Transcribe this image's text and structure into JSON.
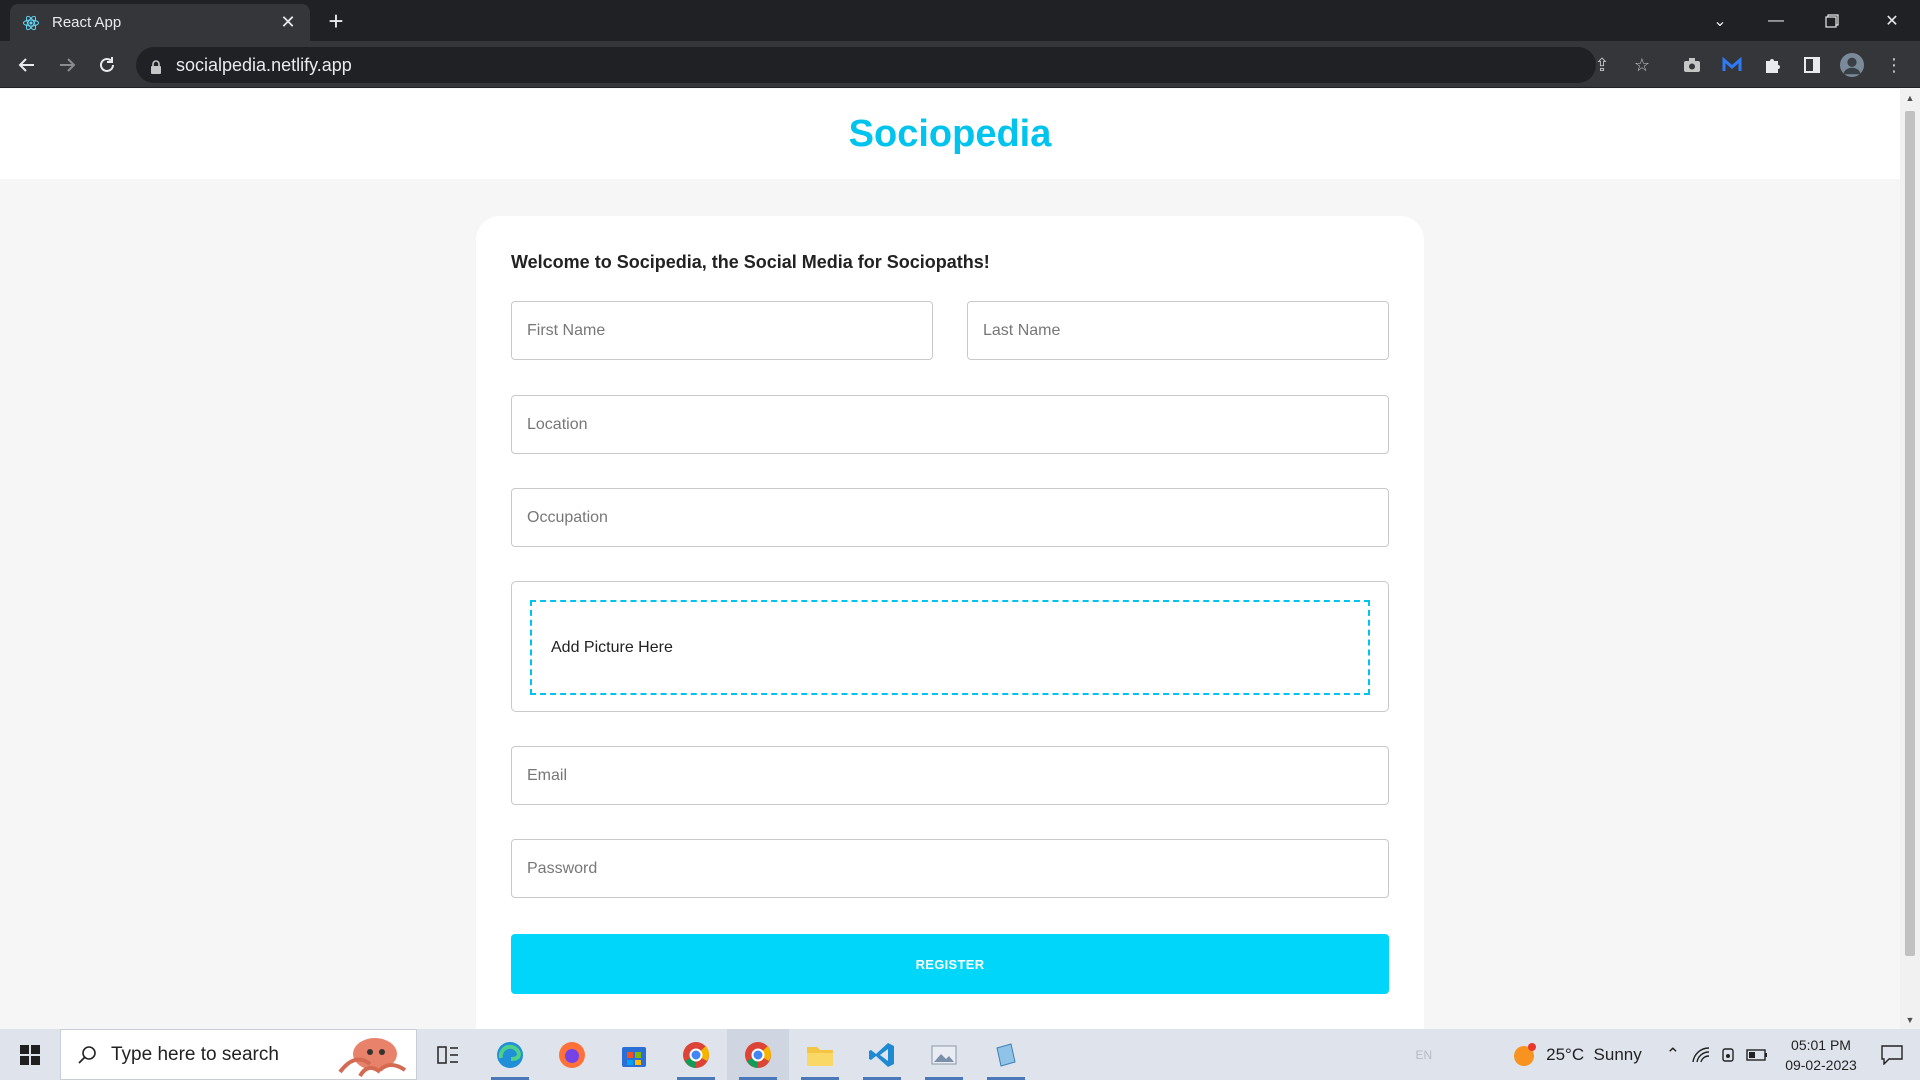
{
  "browser": {
    "tab_title": "React App",
    "url": "socialpedia.netlify.app"
  },
  "app": {
    "brand": "Sociopedia",
    "welcome": "Welcome to Socipedia, the Social Media for Sociopaths!",
    "fields": {
      "first_name": "First Name",
      "last_name": "Last Name",
      "location": "Location",
      "occupation": "Occupation",
      "picture": "Add Picture Here",
      "email": "Email",
      "password": "Password"
    },
    "register_label": "REGISTER",
    "accent_color": "#00d5fa"
  },
  "taskbar": {
    "search_placeholder": "Type here to search",
    "language": "EN",
    "weather": "25°C  Sunny",
    "time": "05:01 PM",
    "date": "09-02-2023"
  }
}
